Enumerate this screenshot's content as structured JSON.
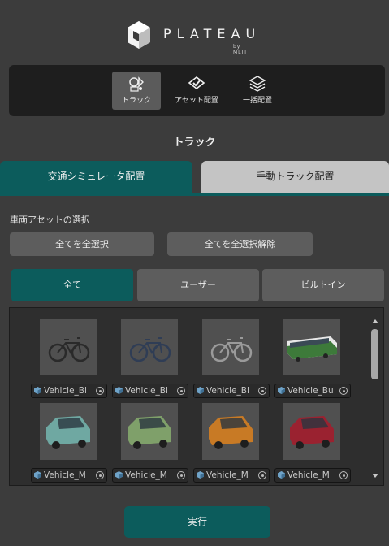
{
  "logo": {
    "word": "PLATEAU",
    "sub": "by MLIT"
  },
  "modes": [
    {
      "label": "トラック",
      "icon": "track-icon",
      "active": true
    },
    {
      "label": "アセット配置",
      "icon": "asset-place-icon",
      "active": false
    },
    {
      "label": "一括配置",
      "icon": "bulk-place-icon",
      "active": false
    }
  ],
  "section_title": "トラック",
  "tabs": {
    "simulator": "交通シミュレータ配置",
    "manual": "手動トラック配置"
  },
  "vehicle_select_label": "車両アセットの選択",
  "select_all": "全てを全選択",
  "deselect_all": "全てを全選択解除",
  "filters": {
    "all": "全て",
    "user": "ユーザー",
    "builtin": "ビルトイン"
  },
  "assets": [
    {
      "name": "Vehicle_Bi",
      "kind": "bicycle",
      "color": "#2a2a2a"
    },
    {
      "name": "Vehicle_Bi",
      "kind": "bicycle",
      "color": "#2f3d55"
    },
    {
      "name": "Vehicle_Bi",
      "kind": "bicycle",
      "color": "#9a9a9a"
    },
    {
      "name": "Vehicle_Bu",
      "kind": "bus",
      "color": "#3d7a3a"
    },
    {
      "name": "Vehicle_M",
      "kind": "van",
      "color": "#6fa8a2"
    },
    {
      "name": "Vehicle_M",
      "kind": "van",
      "color": "#7fa06a"
    },
    {
      "name": "Vehicle_M",
      "kind": "van",
      "color": "#c87a25"
    },
    {
      "name": "Vehicle_M",
      "kind": "van",
      "color": "#9a2230"
    }
  ],
  "run_label": "実行",
  "colors": {
    "accent": "#0c5c5c",
    "background": "#3c3c3c",
    "panel": "#1e1e1e"
  }
}
